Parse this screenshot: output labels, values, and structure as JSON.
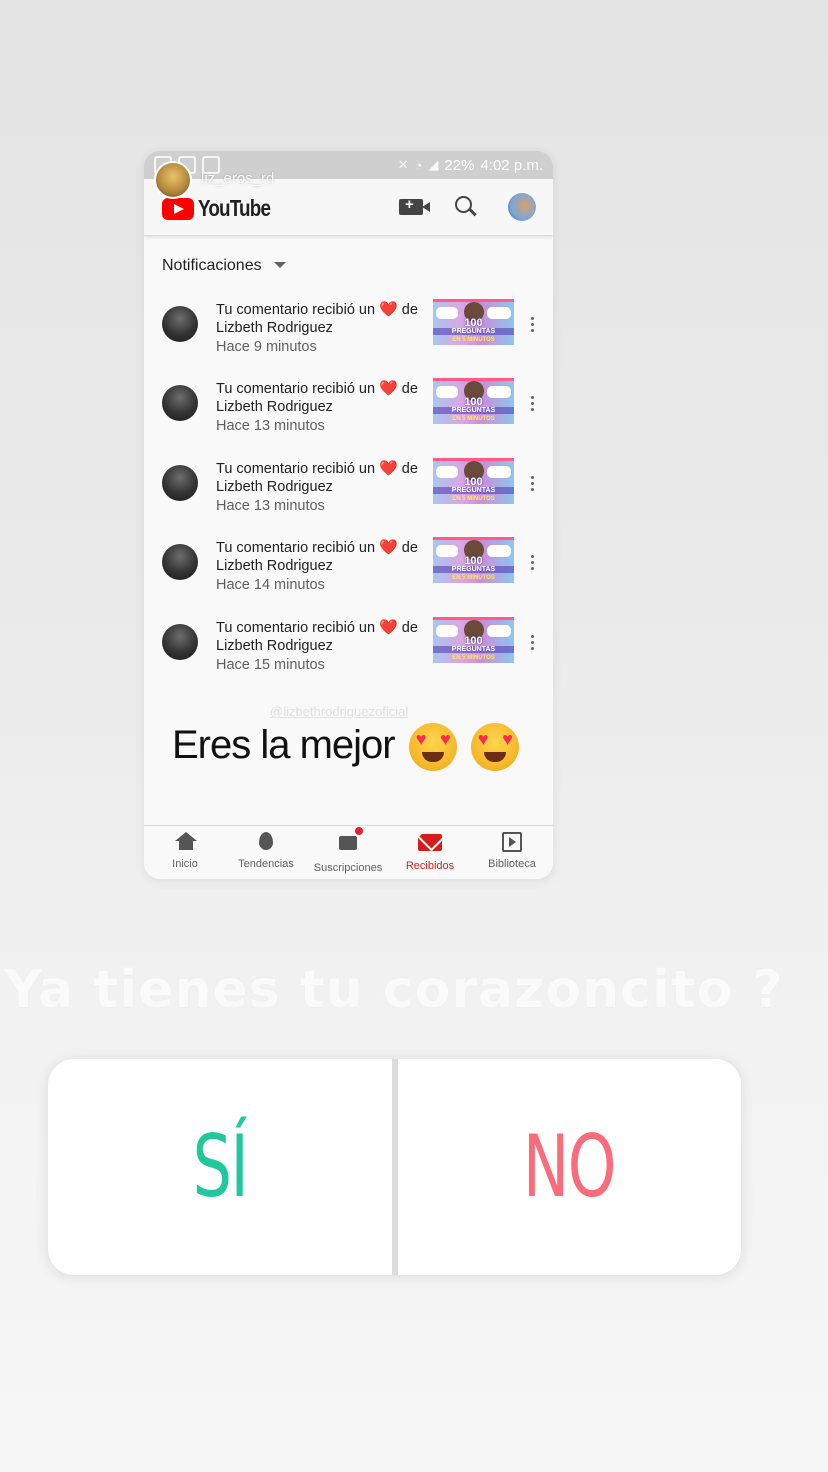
{
  "story": {
    "username": "liz_eros_rd",
    "question": "Ya tienes tu corazoncito ?",
    "poll": {
      "yes_label": "SÍ",
      "no_label": "NO",
      "yes_color": "#21c89b",
      "no_color": "#f76d7b"
    }
  },
  "statusbar": {
    "battery": "22%",
    "time": "4:02 p.m."
  },
  "youtube": {
    "brand": "YouTube",
    "brand_color": "#ff0000",
    "header_icons": [
      "video-camera-icon",
      "search-icon",
      "account-avatar"
    ],
    "section_title": "Notificaciones",
    "notifications": [
      {
        "text_before": "Tu comentario recibió un ",
        "text_after": " de Lizbeth Rodriguez",
        "time": "Hace 9 minutos"
      },
      {
        "text_before": "Tu comentario recibió un ",
        "text_after": " de Lizbeth Rodriguez",
        "time": "Hace 13 minutos"
      },
      {
        "text_before": "Tu comentario recibió un ",
        "text_after": " de Lizbeth Rodriguez",
        "time": "Hace 13 minutos"
      },
      {
        "text_before": "Tu comentario recibió un ",
        "text_after": " de Lizbeth Rodriguez",
        "time": "Hace 14 minutos"
      },
      {
        "text_before": "Tu comentario recibió un ",
        "text_after": " de Lizbeth Rodriguez",
        "time": "Hace 15 minutos"
      }
    ],
    "thumbnail_text": {
      "big": "100",
      "mid": "PREGUNTAS",
      "bot": "EN 5 MINUTOS"
    },
    "watermark": "@lizbethrodriguezoficial",
    "caption": "Eres la mejor",
    "bottom_nav": [
      {
        "label": "Inicio",
        "icon": "home-icon"
      },
      {
        "label": "Tendencias",
        "icon": "fire-icon"
      },
      {
        "label": "Suscripciones",
        "icon": "subscriptions-icon"
      },
      {
        "label": "Recibidos",
        "icon": "mail-icon",
        "active": true
      },
      {
        "label": "Biblioteca",
        "icon": "library-icon"
      }
    ]
  }
}
